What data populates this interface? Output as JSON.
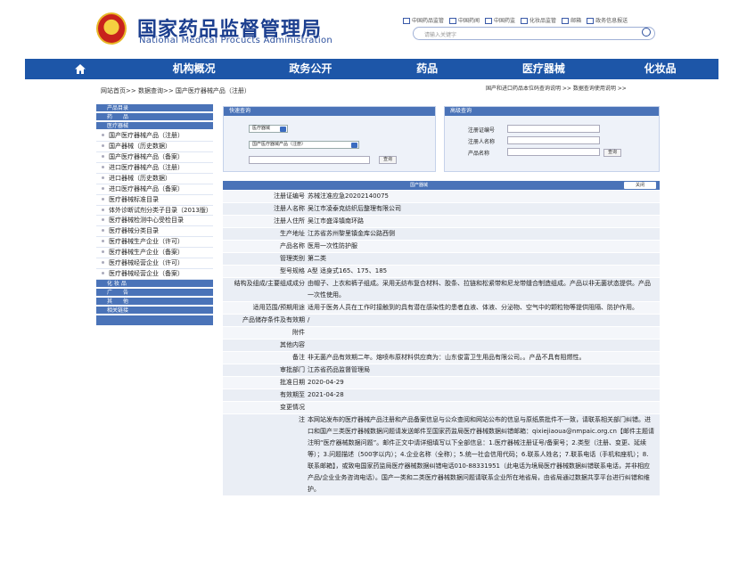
{
  "header": {
    "title": "国家药品监督管理局",
    "subtitle": "National Medical Procucts Administration",
    "links": [
      "中国药品监管",
      "中国药闻",
      "中国药监",
      "化妆品监管",
      "邮箱",
      "政务信息报送"
    ],
    "search_placeholder": "请输入关键字"
  },
  "nav": {
    "home_icon": "home-icon",
    "items": [
      "机构概况",
      "政务公开",
      "药品",
      "医疗器械",
      "化妆品"
    ]
  },
  "breadcrumb": {
    "path": "网站首页>> 数据查询>> 国产医疗器械产品（注册）",
    "right_links": "国产和进口药品本位码查询说明 >>    数据查询使用说明 >>"
  },
  "sidebar": {
    "groups": [
      {
        "head": "产品目录",
        "items": []
      },
      {
        "head": "药　　品",
        "items": []
      },
      {
        "head": "医疗器械",
        "items": [
          "国产医疗器械产品（注册）",
          "国产器械（历史数据）",
          "国产医疗器械产品（备案）",
          "进口医疗器械产品（注册）",
          "进口器械（历史数据）",
          "进口医疗器械产品（备案）",
          "医疗器械标准目录",
          "体外诊断试剂分类子目录（2013版）",
          "医疗器械检测中心受检目录",
          "医疗器械分类目录",
          "医疗器械生产企业（许可）",
          "医疗器械生产企业（备案）",
          "医疗器械经营企业（许可）",
          "医疗器械经营企业（备案）"
        ]
      },
      {
        "head": "化 妆 品",
        "items": []
      },
      {
        "head": "广　　告",
        "items": []
      },
      {
        "head": "其　　他",
        "items": []
      },
      {
        "head": "相关链接",
        "items": []
      }
    ]
  },
  "quick_query": {
    "title": "快速查询",
    "select1": "医疗器械",
    "select2": "国产医疗器械产品（注册）",
    "button": "查询"
  },
  "advanced_query": {
    "title": "高级查询",
    "fields": [
      "注册证编号",
      "注册人名称",
      "产品名称"
    ],
    "button": "查询"
  },
  "detail": {
    "title": "国产器械",
    "close_label": "关闭",
    "rows": [
      {
        "k": "注册证编号",
        "v": "苏械注准应急20202140075"
      },
      {
        "k": "注册人名称",
        "v": "吴江市凌泰克纺织后整理有限公司"
      },
      {
        "k": "注册人住所",
        "v": "吴江市盛泽镇南环路"
      },
      {
        "k": "生产地址",
        "v": "江苏省苏州黎里镇金库公路西侧"
      },
      {
        "k": "产品名称",
        "v": "医用一次性防护服"
      },
      {
        "k": "管理类别",
        "v": "第二类"
      },
      {
        "k": "型号规格",
        "v": "A型 适身式165、175、185"
      },
      {
        "k": "结构及组成/主要组成成分",
        "v": "由帽子、上衣和裤子组成。采用无纺布复合材料、胶条、拉链和松紧带和尼龙带缝合制造组成。产品以非无菌状态提供。产品一次性使用。"
      },
      {
        "k": "适用范围/预期用途",
        "v": "适用于医务人员在工作时接触到的具有潜在感染性的患者血液、体液、分泌物、空气中的颗粒物等提供阻隔、防护作用。"
      },
      {
        "k": "产品储存条件及有效期",
        "v": "/"
      },
      {
        "k": "附件",
        "v": ""
      },
      {
        "k": "其他内容",
        "v": ""
      },
      {
        "k": "备注",
        "v": "非无菌产品有效期二年。熔喷布原材料供应商为：山东俊富卫生用品有限公司。。产品不具有阻燃性。"
      },
      {
        "k": "审批部门",
        "v": "江苏省药品监督管理局"
      },
      {
        "k": "批准日期",
        "v": "2020-04-29"
      },
      {
        "k": "有效期至",
        "v": "2021-04-28"
      },
      {
        "k": "变更情况",
        "v": ""
      }
    ],
    "notice_key": "注",
    "notice": "本网站发布的医疗器械产品注册和产品备案信息与公众查阅和网站公布的信息与原纸质批件不一致，请联系相关部门纠错。进口和国产三类医疗器械数据问题请发送邮件至国家药监局医疗器械数据纠错邮箱：qixiejiaoua@nmpaic.org.cn【邮件主题请注明“医疗器械数据问题”。邮件正文中请详细填写以下全部信息：1.医疗器械注册证号/备案号；2.类型（注册、变更、延续等）；3.问题描述（500字以内）；4.企业名称（全称）；5.统一社会信用代码；6.联系人姓名；7.联系电话（手机和座机）；8.联系邮箱】，或致电国家药监局医疗器械数据纠错电话010-88331951（此电话为境局医疗器械数据纠错联系电话，并非相应产品/企业业务咨询电话）。国产一类和二类医疗器械数据问题请联系企业所在地省局，由省局通过数据共享平台进行纠错和维护。"
  }
}
